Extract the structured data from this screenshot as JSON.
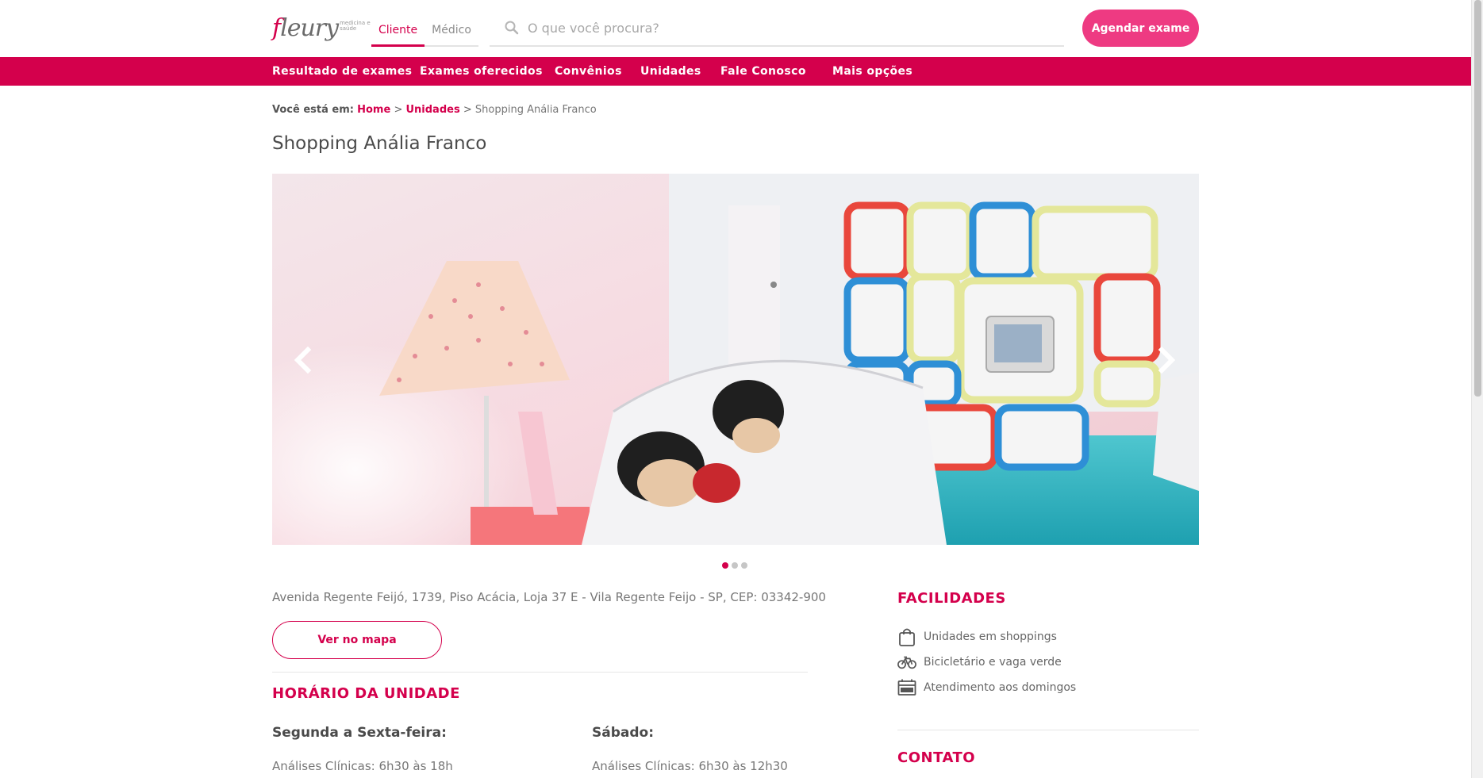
{
  "header": {
    "logo_text": "fleury",
    "logo_tagline": "medicina e saúde",
    "audience_tabs": [
      {
        "label": "Cliente",
        "active": true
      },
      {
        "label": "Médico",
        "active": false
      }
    ],
    "search_placeholder": "O que você procura?",
    "cta_label": "Agendar exame"
  },
  "nav": {
    "items": [
      {
        "label": "Resultado de exames"
      },
      {
        "label": "Exames oferecidos"
      },
      {
        "label": "Convênios"
      },
      {
        "label": "Unidades"
      },
      {
        "label": "Fale Conosco"
      },
      {
        "label": "Mais opções"
      }
    ]
  },
  "breadcrumb": {
    "prefix": "Você está em:",
    "links": [
      "Home",
      "Unidades"
    ],
    "separator": ">",
    "current": "Shopping Anália Franco"
  },
  "page": {
    "title": "Shopping Anália Franco"
  },
  "carousel": {
    "slide_count": 3,
    "active_index": 0,
    "prev_icon": "chevron-left-icon",
    "next_icon": "chevron-right-icon"
  },
  "unit": {
    "address": "Avenida Regente Feijó, 1739, Piso Acácia, Loja 37 E - Vila Regente Feijo - SP, CEP: 03342-900",
    "map_button": "Ver no mapa"
  },
  "hours": {
    "heading": "HORÁRIO DA UNIDADE",
    "weekdays_label": "Segunda a Sexta-feira:",
    "weekdays_value": "Análises Clínicas: 6h30 às 18h",
    "saturday_label": "Sábado:",
    "saturday_value": "Análises Clínicas: 6h30 às 12h30"
  },
  "facilities": {
    "heading": "FACILIDADES",
    "items": [
      {
        "label": "Unidades em shoppings",
        "icon": "shopping-bag-icon"
      },
      {
        "label": "Bicicletário e vaga verde",
        "icon": "bicycle-icon"
      },
      {
        "label": "Atendimento aos domingos",
        "icon": "calendar-sunday-icon"
      }
    ]
  },
  "contact": {
    "heading": "CONTATO"
  },
  "colors": {
    "brand": "#d4004c",
    "cta": "#ee3a82",
    "text": "#4a4a4a",
    "muted": "#777777"
  }
}
